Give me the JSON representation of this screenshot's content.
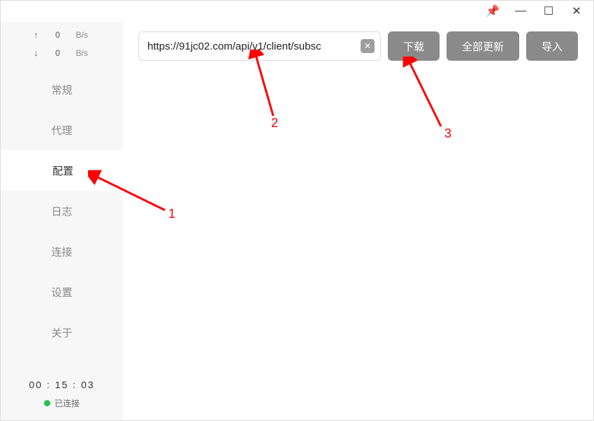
{
  "titlebar": {
    "pin_icon": "📌",
    "minimize_icon": "—",
    "maximize_icon": "☐",
    "close_icon": "✕"
  },
  "speed": {
    "up_arrow": "↑",
    "up_value": "0",
    "up_unit": "B/s",
    "down_arrow": "↓",
    "down_value": "0",
    "down_unit": "B/s"
  },
  "nav": {
    "general": "常规",
    "proxy": "代理",
    "config": "配置",
    "logs": "日志",
    "connections": "连接",
    "settings": "设置",
    "about": "关于"
  },
  "sidebar_bottom": {
    "timer": "00 : 15 : 03",
    "status_text": "已连接"
  },
  "toolbar": {
    "url_value": "https://91jc02.com/api/v1/client/subsc",
    "clear_icon": "✕",
    "download_label": "下载",
    "update_all_label": "全部更新",
    "import_label": "导入"
  },
  "annotations": {
    "label1": "1",
    "label2": "2",
    "label3": "3"
  }
}
